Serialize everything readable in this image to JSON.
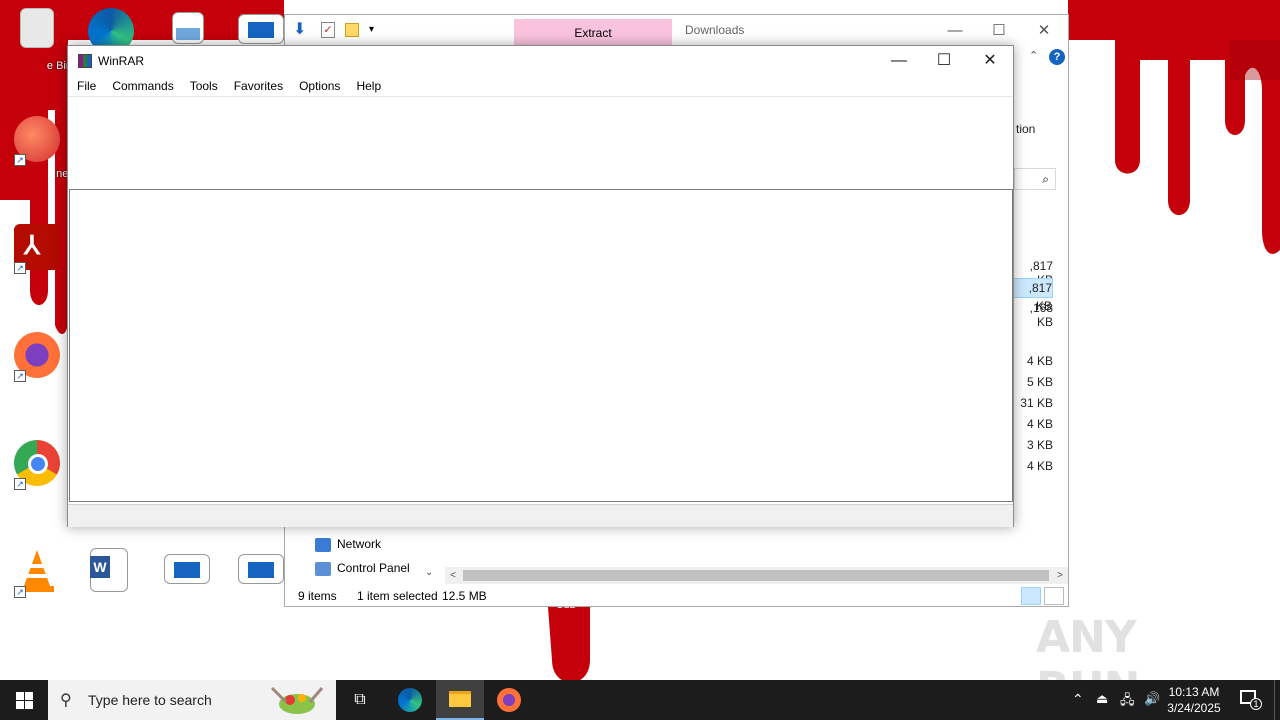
{
  "desktop": {
    "icons": [
      {
        "name": "recycle-bin",
        "label": "e Bin"
      },
      {
        "name": "ccleaner",
        "label": "ner"
      },
      {
        "name": "acrobat-reader",
        "label": ""
      },
      {
        "name": "firefox",
        "label": ""
      },
      {
        "name": "chrome",
        "label": ""
      },
      {
        "name": "vlc",
        "label": ""
      }
    ]
  },
  "explorer": {
    "extract_tab": "Extract",
    "title": "Downloads",
    "ribbon_fragment": "tion",
    "nav": {
      "network": "Network",
      "control_panel": "Control Panel"
    },
    "sizes": [
      ",817 KB",
      ",817 KB",
      ",168 KB",
      "4 KB",
      "5 KB",
      "31 KB",
      "4 KB",
      "3 KB",
      "4 KB"
    ],
    "status": {
      "items": "9 items",
      "selected": "1 item selected",
      "size": "12.5 MB"
    },
    "bg_text": "OLD"
  },
  "winrar": {
    "title": "WinRAR",
    "menu": [
      "File",
      "Commands",
      "Tools",
      "Favorites",
      "Options",
      "Help"
    ]
  },
  "taskbar": {
    "search_placeholder": "Type here to search",
    "time": "10:13 AM",
    "date": "3/24/2025",
    "notification_count": "1"
  },
  "watermark": "ANY RUN",
  "colors": {
    "wallpaper_red": "#c4000b",
    "taskbar": "#1c1c1c",
    "extract_tab": "#f9c3de",
    "accent": "#1565c0"
  }
}
